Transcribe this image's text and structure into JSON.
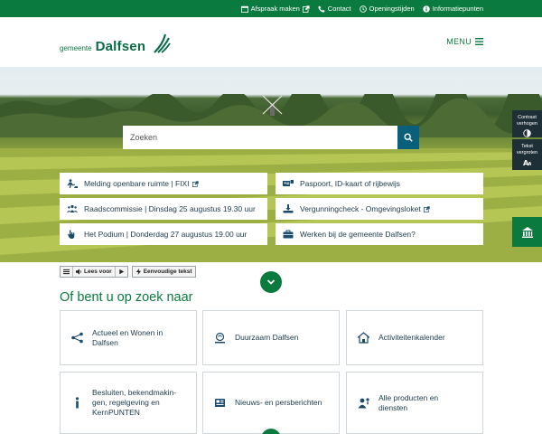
{
  "topbar": {
    "links": [
      {
        "label": "Afspraak maken",
        "icon": "calendar-icon",
        "external": true
      },
      {
        "label": "Contact",
        "icon": "phone-icon",
        "external": false
      },
      {
        "label": "Openingstijden",
        "icon": "clock-icon",
        "external": false
      },
      {
        "label": "Informatiepunten",
        "icon": "info-icon",
        "external": false
      }
    ]
  },
  "header": {
    "logo_small": "gemeente",
    "logo_big": "Dalfsen",
    "menu_label": "MENU"
  },
  "search": {
    "placeholder": "Zoeken"
  },
  "quicklinks": [
    {
      "label": "Melding openbare ruimte | FIXI",
      "icon": "street-work-icon",
      "external": true
    },
    {
      "label": "Paspoort, ID-kaart of rijbewijs",
      "icon": "id-card-icon",
      "external": false
    },
    {
      "label": "Raadscommissie | Dinsdag 25 augustus 19.30 uur",
      "icon": "people-group-icon",
      "external": false
    },
    {
      "label": "Vergunningcheck - Omgevingsloket",
      "icon": "permit-icon",
      "external": true
    },
    {
      "label": "Het Podium | Donderdag 27 augustus 19.00 uur",
      "icon": "hand-icon",
      "external": false
    },
    {
      "label": "Werken bij de gemeente Dalfsen?",
      "icon": "briefcase-icon",
      "external": false
    }
  ],
  "sidetools": {
    "contrast_label": "Contrast verhogen",
    "text_label": "Tekst vergroten"
  },
  "readspeaker": {
    "listen_label": "Lees voor",
    "easy_text_label": "Eenvoudige tekst"
  },
  "section": {
    "title": "Of bent u op zoek naar"
  },
  "cards": [
    {
      "label": "Actueel en Wonen in Dalfsen",
      "icon": "network-icon"
    },
    {
      "label": "Duurzaam Dalfsen",
      "icon": "sustainability-icon"
    },
    {
      "label": "Activiteitenkalender",
      "icon": "house-icon"
    },
    {
      "label": "Besluiten, bekendmakin-gen, regelgeving en KernPUNTEN",
      "icon": "info-icon"
    },
    {
      "label": "Nieuws- en persberichten",
      "icon": "newspaper-icon"
    },
    {
      "label": "Alle producten en diensten",
      "icon": "person-service-icon"
    }
  ],
  "colors": {
    "brand_green": "#0b7a3f",
    "search_blue": "#0a5f7a",
    "dark_tool": "#1f2f38"
  }
}
